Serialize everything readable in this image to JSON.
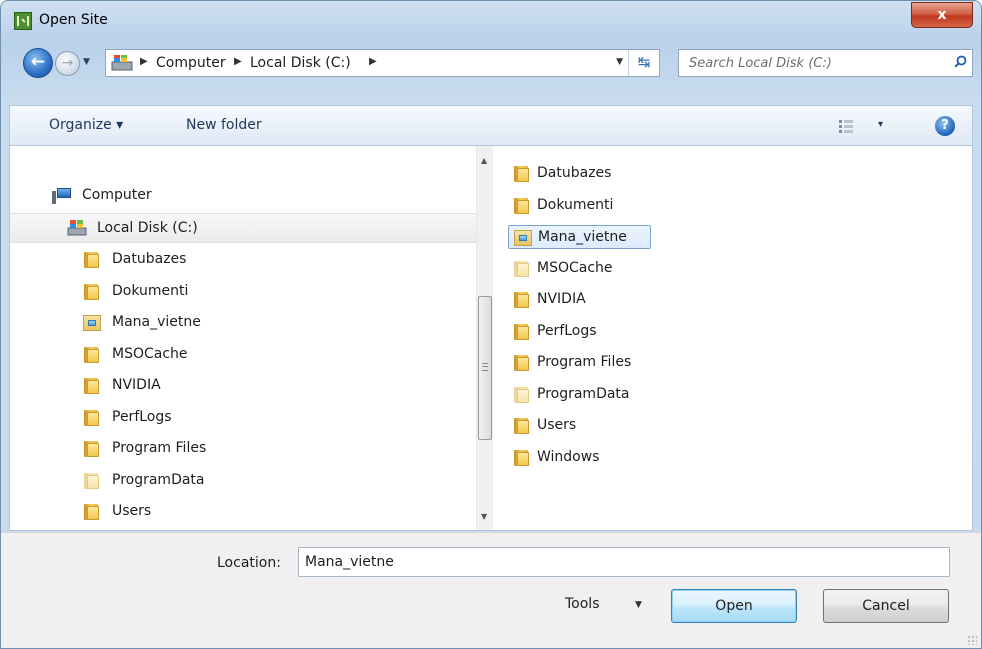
{
  "window": {
    "title": "Open Site",
    "close_label": "x"
  },
  "address_bar": {
    "breadcrumbs": [
      "Computer",
      "Local Disk (C:)"
    ]
  },
  "search": {
    "placeholder": "Search Local Disk (C:)"
  },
  "toolbar": {
    "organize_label": "Organize ▾",
    "new_folder_label": "New folder",
    "views_dd": "▾",
    "help_label": "?"
  },
  "navigation_tree": {
    "computer_label": "Computer",
    "drive_label": "Local Disk (C:)",
    "folders": [
      "Datubazes",
      "Dokumenti",
      "Mana_vietne",
      "MSOCache",
      "NVIDIA",
      "PerfLogs",
      "Program Files",
      "ProgramData",
      "Users"
    ]
  },
  "file_list": {
    "items": [
      "Datubazes",
      "Dokumenti",
      "Mana_vietne",
      "MSOCache",
      "NVIDIA",
      "PerfLogs",
      "Program Files",
      "ProgramData",
      "Users",
      "Windows"
    ],
    "selected": "Mana_vietne"
  },
  "bottom": {
    "location_label": "Location:",
    "location_value": "Mana_vietne",
    "tools_label": "Tools",
    "open_label": "Open",
    "cancel_label": "Cancel"
  }
}
